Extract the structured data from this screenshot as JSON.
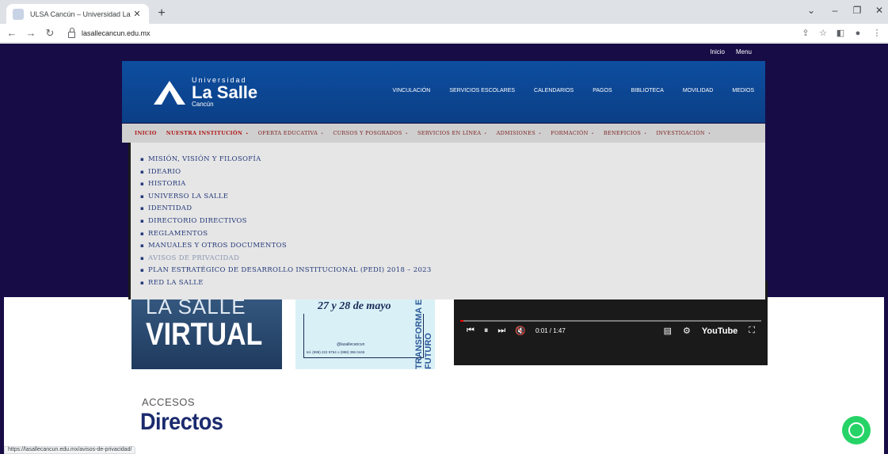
{
  "browser": {
    "tab_title": "ULSA Cancún – Universidad La Sa",
    "tab_close": "✕",
    "new_tab": "+",
    "url": "lasallecancun.edu.mx",
    "status_url": "https://lasallecancun.edu.mx/avisos-de-privacidad/",
    "window_controls": {
      "chevron": "⌄",
      "minimize": "–",
      "restore": "❐",
      "close": "✕"
    },
    "nav": {
      "back": "←",
      "forward": "→",
      "reload": "↻"
    },
    "toolbar_icons": [
      "share-icon",
      "star-icon",
      "sidepanel-icon",
      "profile-icon",
      "menu-icon"
    ]
  },
  "site": {
    "top_links": [
      "Inicio",
      "Menu"
    ],
    "logo": {
      "line1": "Universidad",
      "line2": "La Salle",
      "line3": "Cancún"
    },
    "header_nav": [
      "VINCULACIÓN",
      "SERVICIOS ESCOLARES",
      "CALENDARIOS",
      "PAGOS",
      "BIBLIOTECA",
      "MOVILIDAD",
      "MEDIOS"
    ],
    "main_nav": [
      {
        "label": "INICIO",
        "state": "home"
      },
      {
        "label": "NUESTRA INSTITUCIÓN",
        "state": "active"
      },
      {
        "label": "OFERTA EDUCATIVA",
        "state": "normal"
      },
      {
        "label": "CURSOS Y POSGRADOS",
        "state": "normal"
      },
      {
        "label": "SERVICIOS EN LÍNEA",
        "state": "normal"
      },
      {
        "label": "ADMISIONES",
        "state": "normal"
      },
      {
        "label": "FORMACIÓN",
        "state": "normal"
      },
      {
        "label": "BENEFICIOS",
        "state": "normal"
      },
      {
        "label": "INVESTIGACIÓN",
        "state": "normal"
      }
    ],
    "dropdown_items": [
      {
        "label": "MISIÓN, VISIÓN Y FILOSOFÍA",
        "dim": false
      },
      {
        "label": "IDEARIO",
        "dim": false
      },
      {
        "label": "HISTORIA",
        "dim": false
      },
      {
        "label": "UNIVERSO LA SALLE",
        "dim": false
      },
      {
        "label": "IDENTIDAD",
        "dim": false
      },
      {
        "label": "DIRECTORIO DIRECTIVOS",
        "dim": false
      },
      {
        "label": "REGLAMENTOS",
        "dim": false
      },
      {
        "label": "MANUALES Y OTROS DOCUMENTOS",
        "dim": false
      },
      {
        "label": "AVISOS DE PRIVACIDAD",
        "dim": true
      },
      {
        "label": "PLAN ESTRATÉGICO DE DESARROLLO INSTITUCIONAL (PEDI) 2018 – 2023",
        "dim": false
      },
      {
        "label": "RED LA SALLE",
        "dim": false
      }
    ],
    "banner_virtual": {
      "line1": "LA SALLE",
      "line2": "VIRTUAL"
    },
    "banner_poster": {
      "date": "27 y 28 de mayo",
      "side": "TRANSFORMA EL FUTURO",
      "handle": "@lasallecancun",
      "phone": "tel. (998) 222 9764 o (998) 396 0445"
    },
    "video": {
      "time": "0:01 / 1:47",
      "brand": "YouTube",
      "progress": 0.01
    },
    "accesos": {
      "label": "ACCESOS",
      "title": "Directos"
    }
  },
  "colors": {
    "page_bg": "#170c46",
    "header_blue": "#0d4ea0",
    "nav_red": "#b01c1c",
    "dropdown_text": "#253a7a",
    "accesos_title": "#1b2a6e",
    "whatsapp": "#25d366"
  }
}
